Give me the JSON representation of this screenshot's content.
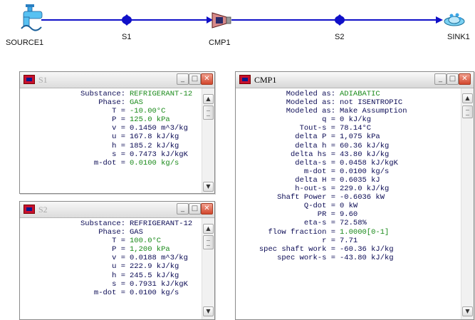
{
  "diagram": {
    "nodes": [
      {
        "id": "source1",
        "label": "SOURCE1"
      },
      {
        "id": "s1",
        "label": "S1"
      },
      {
        "id": "cmp1",
        "label": "CMP1"
      },
      {
        "id": "s2",
        "label": "S2"
      },
      {
        "id": "sink1",
        "label": "SINK1"
      }
    ],
    "colors": {
      "line": "#1010c8",
      "node": "#1010c8"
    }
  },
  "windows": {
    "s1": {
      "title": "S1",
      "rows": [
        {
          "label": "Substance:",
          "value": "REFRIGERANT-12",
          "color": "green"
        },
        {
          "label": "Phase:",
          "value": "GAS",
          "color": "green"
        },
        {
          "label": "T =",
          "value": "-10.00°C",
          "color": "green"
        },
        {
          "label": "P =",
          "value": "125.0 kPa",
          "color": "green"
        },
        {
          "label": "v =",
          "value": "0.1450 m^3/kg",
          "color": "blue"
        },
        {
          "label": "u =",
          "value": "167.8 kJ/kg",
          "color": "blue"
        },
        {
          "label": "h =",
          "value": "185.2 kJ/kg",
          "color": "blue"
        },
        {
          "label": "s =",
          "value": "0.7473 kJ/kgK",
          "color": "blue"
        },
        {
          "label": "m-dot =",
          "value": "0.0100 kg/s",
          "color": "green"
        }
      ]
    },
    "s2": {
      "title": "S2",
      "rows": [
        {
          "label": "Substance:",
          "value": "REFRIGERANT-12",
          "color": "blue"
        },
        {
          "label": "Phase:",
          "value": "GAS",
          "color": "blue"
        },
        {
          "label": "T =",
          "value": "100.0°C",
          "color": "green"
        },
        {
          "label": "P =",
          "value": "1,200 kPa",
          "color": "green"
        },
        {
          "label": "v =",
          "value": "0.0188 m^3/kg",
          "color": "blue"
        },
        {
          "label": "u =",
          "value": "222.9 kJ/kg",
          "color": "blue"
        },
        {
          "label": "h =",
          "value": "245.5 kJ/kg",
          "color": "blue"
        },
        {
          "label": "s =",
          "value": "0.7931 kJ/kgK",
          "color": "blue"
        },
        {
          "label": "m-dot =",
          "value": "0.0100 kg/s",
          "color": "blue"
        }
      ]
    },
    "cmp1": {
      "title": "CMP1",
      "rows": [
        {
          "label": "Modeled as:",
          "value": "ADIABATIC",
          "color": "green"
        },
        {
          "label": "Modeled as:",
          "value": "not ISENTROPIC",
          "color": "blue"
        },
        {
          "label": "Modeled as:",
          "value": "Make Assumption",
          "color": "blue"
        },
        {
          "label": "q =",
          "value": "0 kJ/kg",
          "color": "blue"
        },
        {
          "label": "Tout-s =",
          "value": "78.14°C",
          "color": "blue"
        },
        {
          "label": "delta P =",
          "value": "1,075 kPa",
          "color": "blue"
        },
        {
          "label": "delta h =",
          "value": "60.36 kJ/kg",
          "color": "blue"
        },
        {
          "label": "delta hs =",
          "value": "43.80 kJ/kg",
          "color": "blue"
        },
        {
          "label": "delta-s =",
          "value": "0.0458 kJ/kgK",
          "color": "blue"
        },
        {
          "label": "m-dot =",
          "value": "0.0100 kg/s",
          "color": "blue"
        },
        {
          "label": "delta H =",
          "value": "0.6035 kJ",
          "color": "blue"
        },
        {
          "label": "h-out-s =",
          "value": "229.0 kJ/kg",
          "color": "blue"
        },
        {
          "label": "Shaft Power =",
          "value": "-0.6036 kW",
          "color": "blue"
        },
        {
          "label": "Q-dot =",
          "value": "0 kW",
          "color": "blue"
        },
        {
          "label": "PR =",
          "value": "9.60",
          "color": "blue"
        },
        {
          "label": "eta-s =",
          "value": "72.58%",
          "color": "blue"
        },
        {
          "label": "flow fraction =",
          "value": "1.0000[0-1]",
          "color": "green"
        },
        {
          "label": "r =",
          "value": "7.71",
          "color": "blue"
        },
        {
          "label": "spec shaft work =",
          "value": "-60.36 kJ/kg",
          "color": "blue"
        },
        {
          "label": "spec work-s =",
          "value": "-43.80 kJ/kg",
          "color": "blue"
        }
      ]
    }
  },
  "window_buttons": {
    "minimize": "_",
    "maximize": "□",
    "close": "✕"
  },
  "scroll": {
    "up": "▲",
    "down": "▼"
  }
}
